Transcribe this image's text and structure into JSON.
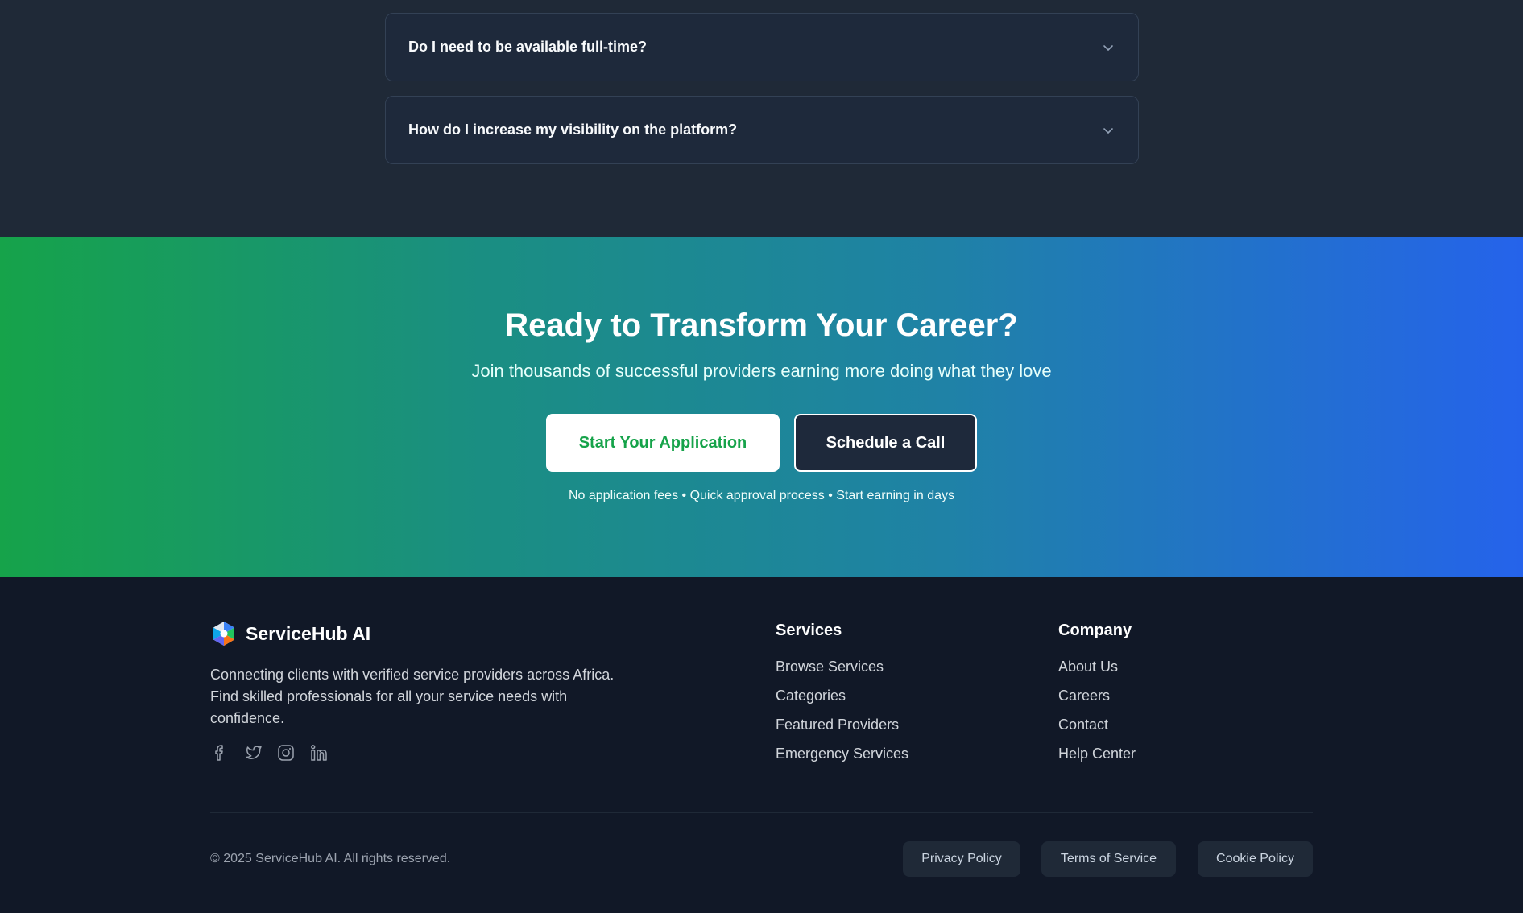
{
  "faq": {
    "items": [
      {
        "question": "Do I need to be available full-time?",
        "icon": "chevron-down-icon"
      },
      {
        "question": "How do I increase my visibility on the platform?",
        "icon": "chevron-down-icon"
      }
    ]
  },
  "cta": {
    "title": "Ready to Transform Your Career?",
    "subtitle": "Join thousands of successful providers earning more doing what they love",
    "primary_button": "Start Your Application",
    "secondary_button": "Schedule a Call",
    "note": "No application fees • Quick approval process • Start earning in days",
    "colors": {
      "gradient_start": "#16a34a",
      "gradient_end": "#2563eb"
    }
  },
  "footer": {
    "brand_name": "ServiceHub AI",
    "description": "Connecting clients with verified service providers across Africa. Find skilled professionals for all your service needs with confidence.",
    "socials": [
      "facebook-icon",
      "twitter-icon",
      "instagram-icon",
      "linkedin-icon"
    ],
    "services": {
      "title": "Services",
      "links": [
        "Browse Services",
        "Categories",
        "Featured Providers",
        "Emergency Services"
      ]
    },
    "company": {
      "title": "Company",
      "links": [
        "About Us",
        "Careers",
        "Contact",
        "Help Center"
      ]
    },
    "copyright": "© 2025 ServiceHub AI. All rights reserved.",
    "legal": {
      "privacy": "Privacy Policy",
      "terms": "Terms of Service",
      "cookie": "Cookie Policy"
    }
  }
}
